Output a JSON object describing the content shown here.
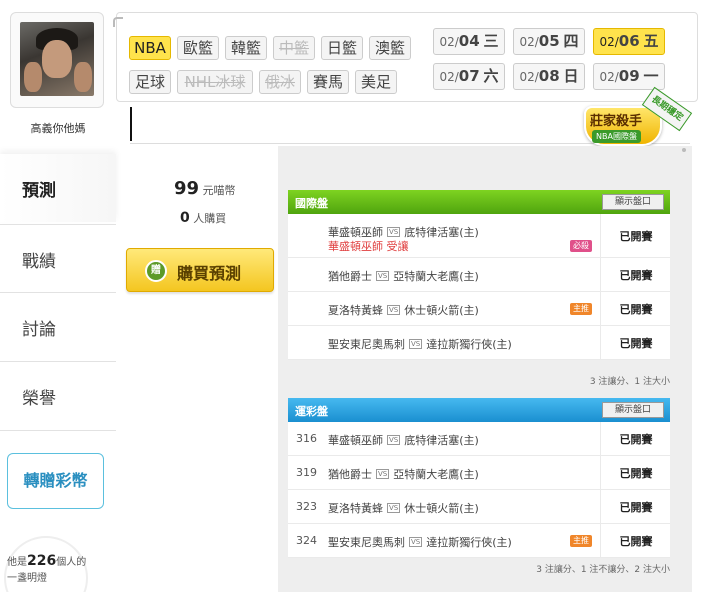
{
  "user": {
    "name": "高義你他媽"
  },
  "nav": {
    "items": [
      {
        "label": "預測"
      },
      {
        "label": "戰績"
      },
      {
        "label": "討論"
      },
      {
        "label": "榮譽"
      }
    ],
    "gift_label": "轉贈彩幣"
  },
  "lamp": {
    "prefix": "他是",
    "count": "226",
    "suffix": "個人的",
    "line2": "一盞明燈"
  },
  "categories": [
    "NBA",
    "歐籃",
    "韓籃",
    "中籃",
    "日籃",
    "澳籃",
    "足球",
    "NHL冰球",
    "俄冰",
    "賽馬",
    "美足"
  ],
  "dates": [
    {
      "md": "02/",
      "day": "04",
      "wd": "三"
    },
    {
      "md": "02/",
      "day": "05",
      "wd": "四"
    },
    {
      "md": "02/",
      "day": "06",
      "wd": "五"
    },
    {
      "md": "02/",
      "day": "07",
      "wd": "六"
    },
    {
      "md": "02/",
      "day": "08",
      "wd": "日"
    },
    {
      "md": "02/",
      "day": "09",
      "wd": "一"
    }
  ],
  "badge": {
    "title": "莊家殺手",
    "subtitle": "NBA國際盤",
    "ribbon": "長期穩定"
  },
  "purchase": {
    "price": "99",
    "price_unit": "元喵幣",
    "buyers": "0",
    "buyers_unit": "人購買",
    "buy_label": "購買預測",
    "coin_icon_text": "贈"
  },
  "intl_table": {
    "title": "國際盤",
    "toggle_label": "顯示盤口",
    "vs_label": "VS",
    "rows": [
      {
        "home": "華盛頓巫師",
        "away": "底特律活塞(主)",
        "sub_team": "華盛頓巫師",
        "sub_note": "受讓",
        "tag": "必殺",
        "status": "已開賽"
      },
      {
        "home": "猶他爵士",
        "away": "亞特蘭大老鷹(主)",
        "status": "已開賽"
      },
      {
        "home": "夏洛特黃蜂",
        "away": "休士頓火箭(主)",
        "tag": "主推",
        "status": "已開賽"
      },
      {
        "home": "聖安東尼奧馬刺",
        "away": "達拉斯獨行俠(主)",
        "status": "已開賽"
      }
    ],
    "summary": "3 注讓分、1 注大小"
  },
  "lottery_table": {
    "title": "運彩盤",
    "toggle_label": "顯示盤口",
    "vs_label": "VS",
    "rows": [
      {
        "num": "316",
        "home": "華盛頓巫師",
        "away": "底特律活塞(主)",
        "status": "已開賽"
      },
      {
        "num": "319",
        "home": "猶他爵士",
        "away": "亞特蘭大老鷹(主)",
        "status": "已開賽"
      },
      {
        "num": "323",
        "home": "夏洛特黃蜂",
        "away": "休士頓火箭(主)",
        "status": "已開賽"
      },
      {
        "num": "324",
        "home": "聖安東尼奧馬刺",
        "away": "達拉斯獨行俠(主)",
        "tag": "主推",
        "status": "已開賽"
      }
    ],
    "summary": "3 注讓分、1 注不讓分、2 注大小"
  },
  "colors": {
    "accent_yellow": "#ffe34c",
    "intl_green": "#5cb615",
    "lottery_blue": "#1a8fd0",
    "tag_pink": "#e0508a",
    "tag_orange": "#f0862a"
  }
}
